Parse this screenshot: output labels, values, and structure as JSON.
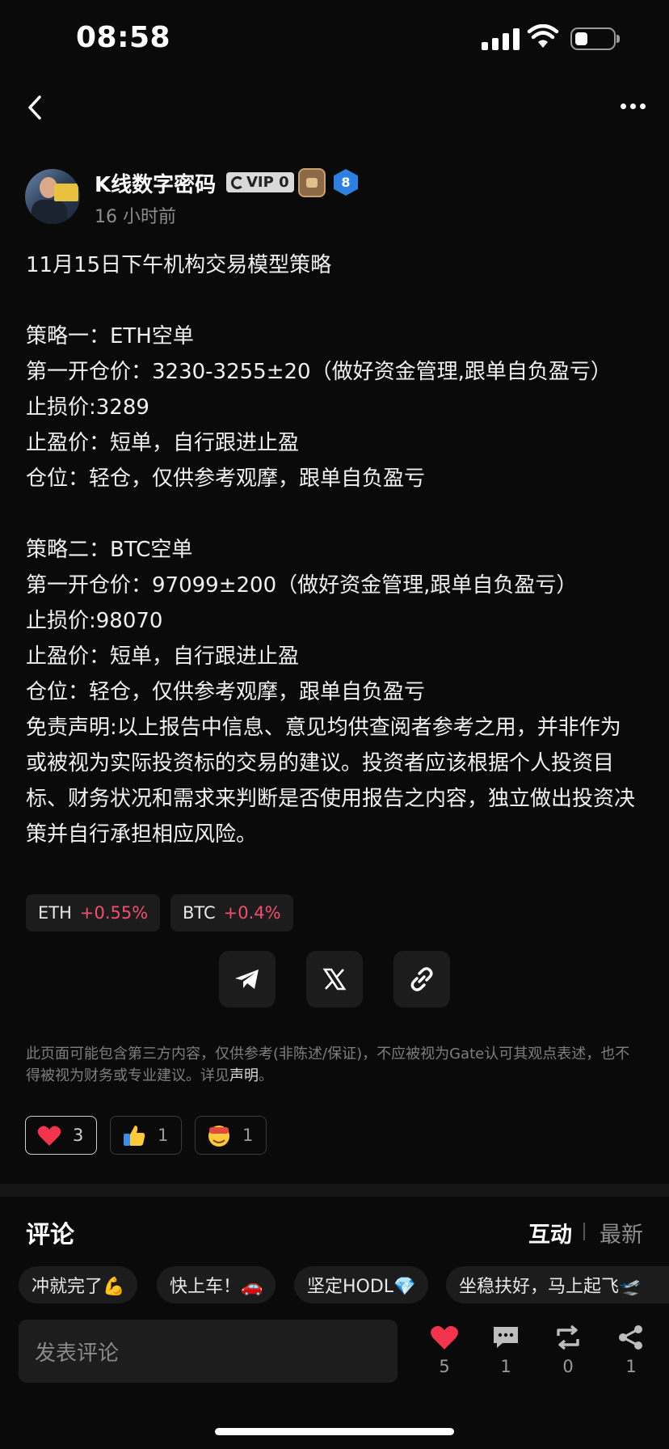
{
  "status_bar": {
    "time": "08:58",
    "battery_level": 0.3
  },
  "author": {
    "name": "K线数字密码",
    "vip": "VIP 0",
    "level_badge": "8",
    "time": "16 小时前"
  },
  "post": {
    "lines": [
      "11月15日下午机构交易模型策略",
      "",
      "策略一：ETH空单",
      "第一开仓价：3230-3255±20（做好资金管理,跟单自负盈亏）",
      "止损价:3289",
      "止盈价：短单，自行跟进止盈",
      "仓位：轻仓，仅供参考观摩，跟单自负盈亏",
      "",
      "策略二：BTC空单",
      "第一开仓价：97099±200（做好资金管理,跟单自负盈亏）",
      "止损价:98070",
      "止盈价：短单，自行跟进止盈",
      "仓位：轻仓，仅供参考观摩，跟单自负盈亏",
      "免责声明:以上报告中信息、意见均供查阅者参考之用，并非作为或被视为实际投资标的交易的建议。投资者应该根据个人投资目标、财务状况和需求来判断是否使用报告之内容，独立做出投资决策并自行承担相应风险。"
    ]
  },
  "tickers": [
    {
      "symbol": "ETH",
      "change": "+0.55%"
    },
    {
      "symbol": "BTC",
      "change": "+0.4%"
    }
  ],
  "share_icons": [
    "telegram-icon",
    "x-icon",
    "link-icon"
  ],
  "disclaimer": {
    "text": "此页面可能包含第三方内容，仅供参考(非陈述/保证)，不应被视为Gate认可其观点表述，也不得被视为财务或专业建议。详见",
    "link": "声明",
    "end": "。"
  },
  "reactions": [
    {
      "icon": "heart-icon",
      "count": "3"
    },
    {
      "icon": "thumbs-up-icon",
      "count": "1"
    },
    {
      "icon": "money-face-icon",
      "count": "1"
    }
  ],
  "comments": {
    "title": "评论",
    "tab_active": "互动",
    "tab_other": "最新",
    "quick_replies": [
      "冲就完了💪",
      "快上车！🚗",
      "坚定HODL💎",
      "坐稳扶好，马上起飞🛫"
    ],
    "input_placeholder": "发表评论"
  },
  "actions": [
    {
      "icon": "heart-icon",
      "count": "5"
    },
    {
      "icon": "comment-icon",
      "count": "1"
    },
    {
      "icon": "repost-icon",
      "count": "0"
    },
    {
      "icon": "share-icon",
      "count": "1"
    }
  ],
  "colors": {
    "positive_change": "#f0506e",
    "heart": "#f2354c",
    "background": "#0a0a0a"
  }
}
